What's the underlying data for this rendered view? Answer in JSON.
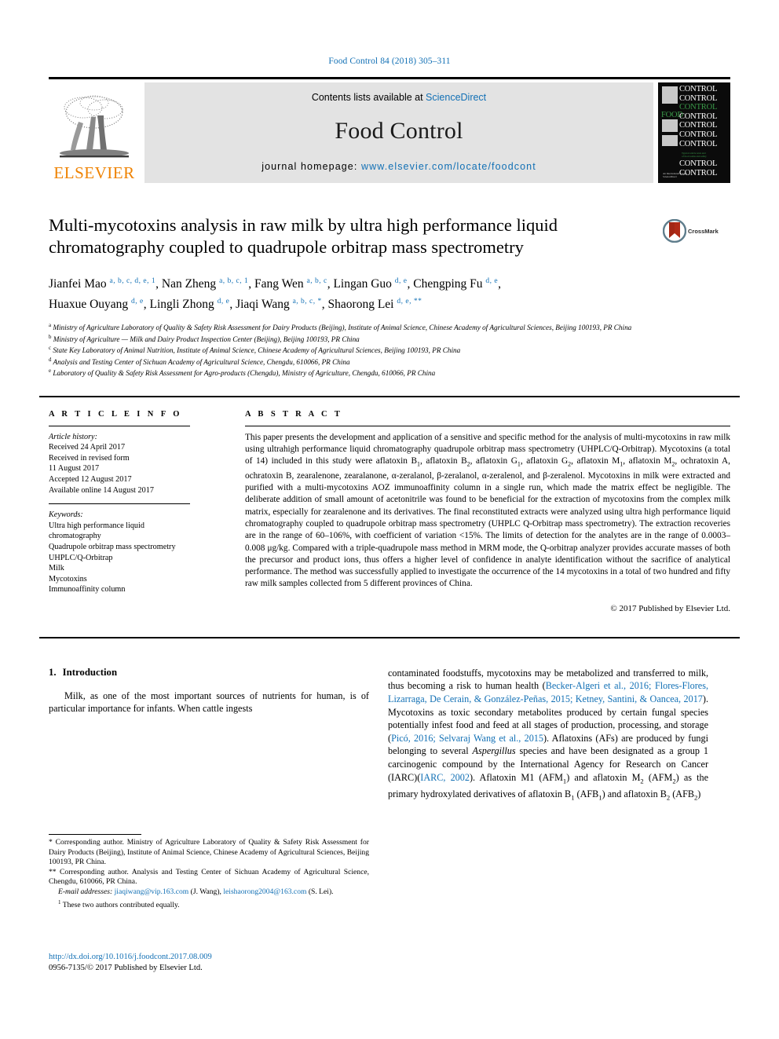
{
  "running_head": "Food Control 84 (2018) 305–311",
  "masthead": {
    "publisher": "ELSEVIER",
    "contents_prefix": "Contents lists available at ",
    "contents_link": "ScienceDirect",
    "journal_title": "Food Control",
    "homepage_prefix": "journal homepage: ",
    "homepage_url": "www.elsevier.com/locate/foodcont",
    "cover_words": [
      "CONTROL",
      "CONTROL",
      "CONTROL",
      "CONTROL",
      "CONTROL",
      "CONTROL",
      "CONTROL",
      "CONTROL",
      "CONTROL"
    ],
    "cover_food": "FOOD"
  },
  "article": {
    "title": "Multi-mycotoxins analysis in raw milk by ultra high performance liquid chromatography coupled to quadrupole orbitrap mass spectrometry",
    "crossmark_label": "CrossMark",
    "authors_line_1": "Jianfei Mao a, b, c, d, e, 1, Nan Zheng a, b, c, 1, Fang Wen a, b, c, Lingan Guo d, e, Chengping Fu d, e,",
    "authors_line_2": "Huaxue Ouyang d, e, Lingli Zhong d, e, Jiaqi Wang a, b, c, *, Shaorong Lei d, e, **",
    "authors": [
      {
        "name": "Jianfei Mao",
        "sup": "a, b, c, d, e, 1"
      },
      {
        "name": "Nan Zheng",
        "sup": "a, b, c, 1"
      },
      {
        "name": "Fang Wen",
        "sup": "a, b, c"
      },
      {
        "name": "Lingan Guo",
        "sup": "d, e"
      },
      {
        "name": "Chengping Fu",
        "sup": "d, e"
      },
      {
        "name": "Huaxue Ouyang",
        "sup": "d, e"
      },
      {
        "name": "Lingli Zhong",
        "sup": "d, e"
      },
      {
        "name": "Jiaqi Wang",
        "sup": "a, b, c, *"
      },
      {
        "name": "Shaorong Lei",
        "sup": "d, e, **"
      }
    ],
    "affiliations": [
      {
        "marker": "a",
        "text": "Ministry of Agriculture Laboratory of Quality & Safety Risk Assessment for Dairy Products (Beijing), Institute of Animal Science, Chinese Academy of Agricultural Sciences, Beijing 100193, PR China"
      },
      {
        "marker": "b",
        "text": "Ministry of Agriculture — Milk and Dairy Product Inspection Center (Beijing), Beijing 100193, PR China"
      },
      {
        "marker": "c",
        "text": "State Key Laboratory of Animal Nutrition, Institute of Animal Science, Chinese Academy of Agricultural Sciences, Beijing 100193, PR China"
      },
      {
        "marker": "d",
        "text": "Analysis and Testing Center of Sichuan Academy of Agricultural Science, Chengdu, 610066, PR China"
      },
      {
        "marker": "e",
        "text": "Laboratory of Quality & Safety Risk Assessment for Agro-products (Chengdu), Ministry of Agriculture, Chengdu, 610066, PR China"
      }
    ]
  },
  "article_info": {
    "heading": "A R T I C L E   I N F O",
    "history_label": "Article history:",
    "history": [
      "Received 24 April 2017",
      "Received in revised form",
      "11 August 2017",
      "Accepted 12 August 2017",
      "Available online 14 August 2017"
    ],
    "keywords_label": "Keywords:",
    "keywords": [
      "Ultra high performance liquid",
      "chromatography",
      "Quadrupole orbitrap mass spectrometry",
      "UHPLC/Q-Orbitrap",
      "Milk",
      "Mycotoxins",
      "Immunoaffinity column"
    ]
  },
  "abstract": {
    "heading": "A B S T R A C T",
    "text": "This paper presents the development and application of a sensitive and specific method for the analysis of multi-mycotoxins in raw milk using ultrahigh performance liquid chromatography quadrupole orbitrap mass spectrometry (UHPLC/Q-Orbitrap). Mycotoxins (a total of 14) included in this study were aflatoxin B1, aflatoxin B2, aflatoxin G1, aflatoxin G2, aflatoxin M1, aflatoxin M2, ochratoxin A, ochratoxin B, zearalenone, zearalanone, α-zeralanol, β-zeralanol, α-zeralenol, and β-zeralenol. Mycotoxins in milk were extracted and purified with a multi-mycotoxins AOZ immunoaffinity column in a single run, which made the matrix effect be negligible. The deliberate addition of small amount of acetonitrile was found to be beneficial for the extraction of mycotoxins from the complex milk matrix, especially for zearalenone and its derivatives. The final reconstituted extracts were analyzed using ultra high performance liquid chromatography coupled to quadrupole orbitrap mass spectrometry (UHPLC Q-Orbitrap mass spectrometry). The extraction recoveries are in the range of 60–106%, with coefficient of variation <15%. The limits of detection for the analytes are in the range of 0.0003–0.008 μg/kg. Compared with a triple-quadrupole mass method in MRM mode, the Q-orbitrap analyzer provides accurate masses of both the precursor and product ions, thus offers a higher level of confidence in analyte identification without the sacrifice of analytical performance. The method was successfully applied to investigate the occurrence of the 14 mycotoxins in a total of two hundred and fifty raw milk samples collected from 5 different provinces of China.",
    "copyright": "© 2017 Published by Elsevier Ltd."
  },
  "introduction": {
    "number": "1.",
    "title": "Introduction",
    "left_paragraph": "Milk, as one of the most important sources of nutrients for human, is of particular importance for infants. When cattle ingests",
    "right_paragraph_parts": [
      {
        "t": "contaminated foodstuffs, mycotoxins may be metabolized and transferred to milk, thus becoming a risk to human health (",
        "s": "plain"
      },
      {
        "t": "Becker-Algeri et al., 2016; Flores-Flores, Lizarraga, De Cerain, & González-Peñas, 2015; Ketney, Santini, & Oancea, 2017",
        "s": "cite"
      },
      {
        "t": "). Mycotoxins as toxic secondary metabolites produced by certain fungal species potentially infest food and feed at all stages of production, processing, and storage (",
        "s": "plain"
      },
      {
        "t": "Picó, 2016; Selvaraj Wang et al., 2015",
        "s": "cite"
      },
      {
        "t": "). Aflatoxins (AFs) are produced by fungi belonging to several ",
        "s": "plain"
      },
      {
        "t": "Aspergillus",
        "s": "italic"
      },
      {
        "t": " species and have been designated as a group 1 carcinogenic compound by the International Agency for Research on Cancer (IARC)(",
        "s": "plain"
      },
      {
        "t": "IARC, 2002",
        "s": "cite"
      },
      {
        "t": "). Aflatoxin M1 (AFM1) and aflatoxin M2 (AFM2) as the primary hydroxylated derivatives of aflatoxin B1 (AFB1) and aflatoxin B2 (AFB2)",
        "s": "plain"
      }
    ]
  },
  "footnotes": {
    "corresponding_1": "* Corresponding author. Ministry of Agriculture Laboratory of Quality & Safety Risk Assessment for Dairy Products (Beijing), Institute of Animal Science, Chinese Academy of Agricultural Sciences, Beijing 100193, PR China.",
    "corresponding_2": "** Corresponding author. Analysis and Testing Center of Sichuan Academy of Agricultural Science, Chengdu, 610066, PR China.",
    "email_label": "E-mail addresses:",
    "email_1": "jiaqiwang@vip.163.com",
    "email_1_owner": "(J. Wang),",
    "email_2": "leishaorong2004@163.com",
    "email_2_owner": "(S. Lei).",
    "equal_contrib": "These two authors contributed equally.",
    "equal_contrib_marker": "1"
  },
  "footer": {
    "doi": "http://dx.doi.org/10.1016/j.foodcont.2017.08.009",
    "issn_line": "0956-7135/© 2017 Published by Elsevier Ltd."
  },
  "colors": {
    "link": "#1270b5",
    "elsevier_orange": "#ef8200",
    "masthead_bg": "#e3e3e3",
    "cover_green": "#3a9a49",
    "crossmark_red": "#b02b17"
  }
}
